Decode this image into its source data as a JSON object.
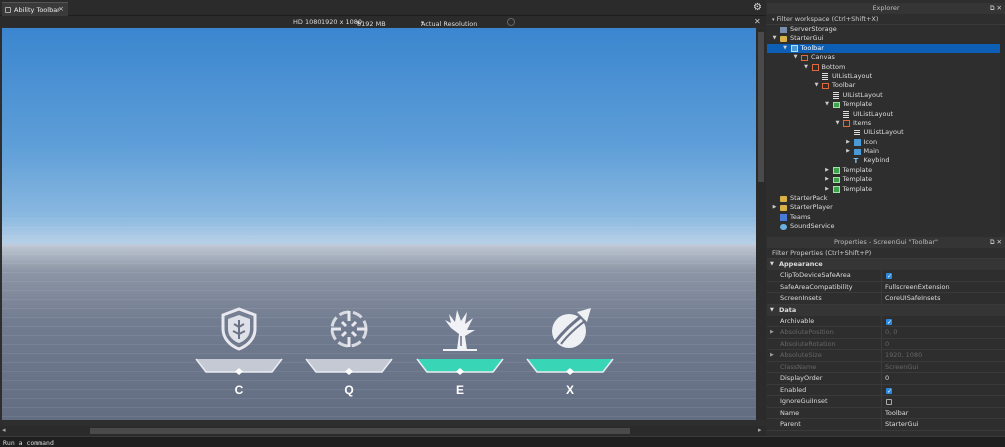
{
  "tab": {
    "title": "Ability Toolbar",
    "close": "×"
  },
  "devbar": {
    "device": "HD 1080",
    "resolution": "1920 x 1080",
    "memory": "8192 MB",
    "scale_mode": "Actual Resolution",
    "caret": "▾"
  },
  "abilities": [
    {
      "key": "C",
      "icon": "shield-icon",
      "fill_color": "#c5c9d3",
      "cooldown_ready": false
    },
    {
      "key": "Q",
      "icon": "target-icon",
      "fill_color": "#c5c9d3",
      "cooldown_ready": false
    },
    {
      "key": "E",
      "icon": "tree-icon",
      "fill_color": "#38d6b6",
      "cooldown_ready": true
    },
    {
      "key": "X",
      "icon": "slash-orb-icon",
      "fill_color": "#38d6b6",
      "cooldown_ready": true
    }
  ],
  "command_bar": {
    "placeholder": "Run a command"
  },
  "explorer": {
    "title": "Explorer",
    "filter_placeholder": "Filter workspace (Ctrl+Shift+X)",
    "items": [
      {
        "label": "ServerStorage",
        "icon": "storage",
        "depth": 0,
        "arrow": ""
      },
      {
        "label": "StarterGui",
        "icon": "folder",
        "depth": 0,
        "arrow": "▼"
      },
      {
        "label": "Toolbar",
        "icon": "gui",
        "depth": 1,
        "arrow": "▼",
        "selected": true
      },
      {
        "label": "Canvas",
        "icon": "frame",
        "depth": 2,
        "arrow": "▼"
      },
      {
        "label": "Bottom",
        "icon": "frame",
        "depth": 3,
        "arrow": "▼"
      },
      {
        "label": "UIListLayout",
        "icon": "list",
        "depth": 4,
        "arrow": ""
      },
      {
        "label": "Toolbar",
        "icon": "frame",
        "depth": 4,
        "arrow": "▼"
      },
      {
        "label": "UIListLayout",
        "icon": "list",
        "depth": 5,
        "arrow": ""
      },
      {
        "label": "Template",
        "icon": "green",
        "depth": 5,
        "arrow": "▼"
      },
      {
        "label": "UIListLayout",
        "icon": "list",
        "depth": 6,
        "arrow": ""
      },
      {
        "label": "Items",
        "icon": "frame",
        "depth": 6,
        "arrow": "▼"
      },
      {
        "label": "UIListLayout",
        "icon": "list",
        "depth": 7,
        "arrow": ""
      },
      {
        "label": "Icon",
        "icon": "img",
        "depth": 7,
        "arrow": "▶"
      },
      {
        "label": "Main",
        "icon": "img",
        "depth": 7,
        "arrow": "▶"
      },
      {
        "label": "Keybind",
        "icon": "text",
        "depth": 7,
        "arrow": ""
      },
      {
        "label": "Template",
        "icon": "green",
        "depth": 5,
        "arrow": "▶"
      },
      {
        "label": "Template",
        "icon": "green",
        "depth": 5,
        "arrow": "▶"
      },
      {
        "label": "Template",
        "icon": "green",
        "depth": 5,
        "arrow": "▶"
      },
      {
        "label": "StarterPack",
        "icon": "folder",
        "depth": 0,
        "arrow": ""
      },
      {
        "label": "StarterPlayer",
        "icon": "folder",
        "depth": 0,
        "arrow": "▶"
      },
      {
        "label": "Teams",
        "icon": "team",
        "depth": 0,
        "arrow": ""
      },
      {
        "label": "SoundService",
        "icon": "sound",
        "depth": 0,
        "arrow": ""
      }
    ]
  },
  "properties": {
    "title": "Properties - ScreenGui \"Toolbar\"",
    "filter_placeholder": "Filter Properties (Ctrl+Shift+P)",
    "sections": [
      {
        "name": "Appearance",
        "rows": [
          {
            "name": "ClipToDeviceSafeArea",
            "type": "check",
            "value": true
          },
          {
            "name": "SafeAreaCompatibility",
            "type": "text",
            "value": "FullscreenExtension"
          },
          {
            "name": "ScreenInsets",
            "type": "text",
            "value": "CoreUISafeInsets"
          }
        ]
      },
      {
        "name": "Data",
        "rows": [
          {
            "name": "Archivable",
            "type": "check",
            "value": true
          },
          {
            "name": "AbsolutePosition",
            "type": "text",
            "value": "0, 0",
            "disabled": true,
            "expandable": true
          },
          {
            "name": "AbsoluteRotation",
            "type": "text",
            "value": "0",
            "disabled": true
          },
          {
            "name": "AbsoluteSize",
            "type": "text",
            "value": "1920, 1080",
            "disabled": true,
            "expandable": true
          },
          {
            "name": "ClassName",
            "type": "text",
            "value": "ScreenGui",
            "disabled": true
          },
          {
            "name": "DisplayOrder",
            "type": "text",
            "value": "0"
          },
          {
            "name": "Enabled",
            "type": "check",
            "value": true
          },
          {
            "name": "IgnoreGuiInset",
            "type": "check",
            "value": false
          },
          {
            "name": "Name",
            "type": "text",
            "value": "Toolbar"
          },
          {
            "name": "Parent",
            "type": "text",
            "value": "StarterGui"
          }
        ]
      }
    ]
  }
}
